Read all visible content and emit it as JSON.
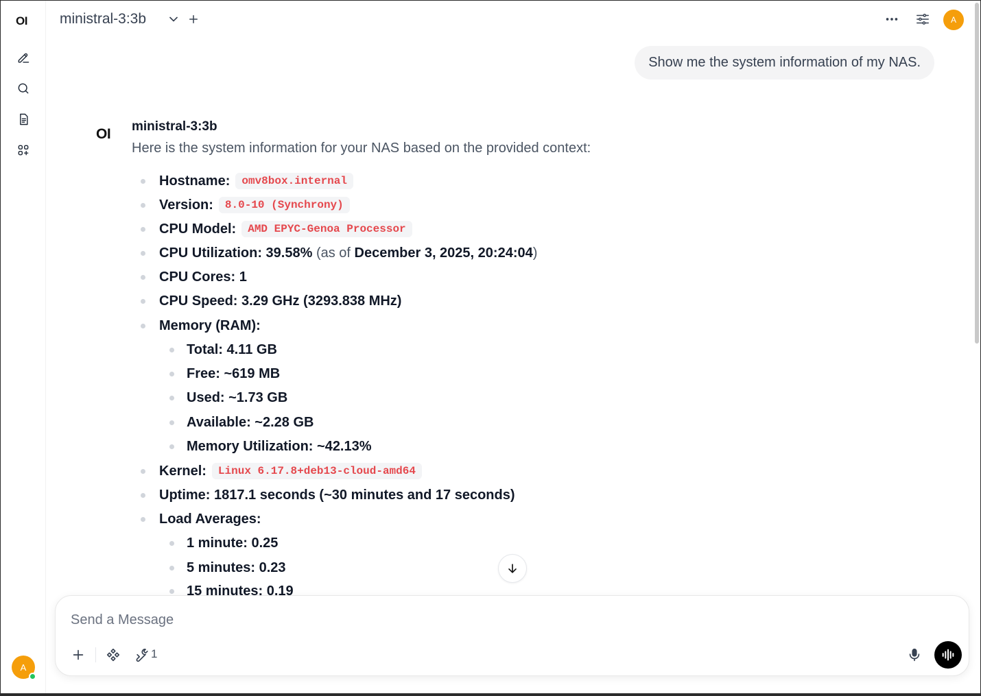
{
  "sidebar": {
    "logo": "OI",
    "items": [
      {
        "icon": "new-chat-icon"
      },
      {
        "icon": "search-icon"
      },
      {
        "icon": "notes-icon"
      },
      {
        "icon": "workspace-icon"
      }
    ],
    "user_initial": "A"
  },
  "header": {
    "model": "ministral-3:3b",
    "user_initial": "A"
  },
  "conversation": {
    "user_message": "Show me the system information of my NAS.",
    "assistant": {
      "logo": "OI",
      "name": "ministral-3:3b",
      "intro": "Here is the system information for your NAS based on the provided context:",
      "items": {
        "hostname_label": "Hostname:",
        "hostname_value": "omv8box.internal",
        "version_label": "Version:",
        "version_value": "8.0-10 (Synchrony)",
        "cpu_model_label": "CPU Model:",
        "cpu_model_value": "AMD EPYC-Genoa Processor",
        "cpu_util_label": "CPU Utilization: 39.58%",
        "cpu_util_as_of": "(as of",
        "cpu_util_date": "December 3, 2025, 20:24:04",
        "cpu_util_close": ")",
        "cpu_cores": "CPU Cores: 1",
        "cpu_speed": "CPU Speed: 3.29 GHz (3293.838 MHz)",
        "memory_label": "Memory (RAM):",
        "mem_total": "Total: 4.11 GB",
        "mem_free": "Free: ~619 MB",
        "mem_used": "Used: ~1.73 GB",
        "mem_available": "Available: ~2.28 GB",
        "mem_util": "Memory Utilization: ~42.13%",
        "kernel_label": "Kernel:",
        "kernel_value": "Linux 6.17.8+deb13-cloud-amd64",
        "uptime": "Uptime: 1817.1 seconds (~30 minutes and 17 seconds)",
        "load_label": "Load Averages:",
        "load_1": "1 minute: 0.25",
        "load_5": "5 minutes: 0.23",
        "load_15": "15 minutes: 0.19"
      }
    }
  },
  "composer": {
    "placeholder": "Send a Message",
    "tools_count": "1"
  },
  "colors": {
    "accent_avatar": "#f59e0b",
    "code_text": "#e5484d",
    "online": "#22c55e"
  }
}
